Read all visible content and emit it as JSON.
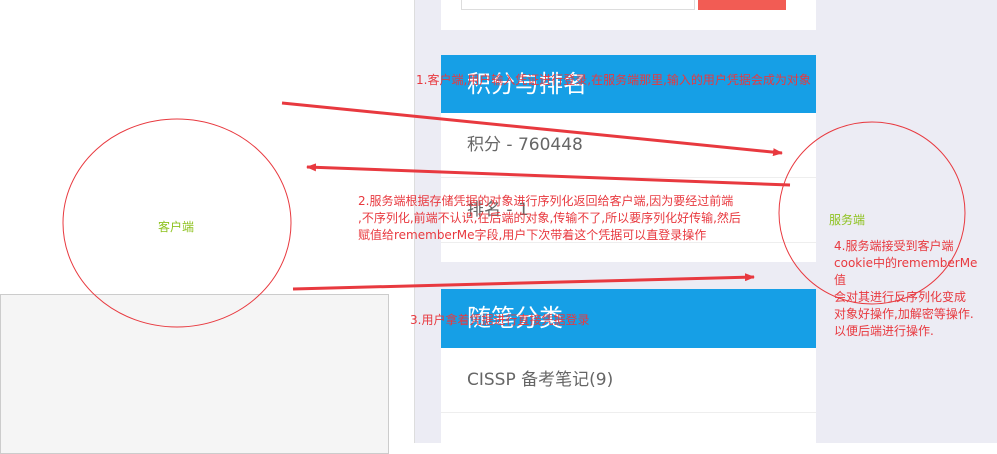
{
  "sidebar": {
    "points_widget": {
      "title": "积分与排名",
      "points": "积分 - 760448",
      "rank": "排名 - 1"
    },
    "categories_widget": {
      "title": "随笔分类",
      "items": [
        "CISSP 备考笔记(9)"
      ]
    }
  },
  "diagram": {
    "client_label": "客户端",
    "server_label": "服务端",
    "step1": "1.客户端,用户输入凭证进行登录,在服务端那里,输入的用户凭据会成为对象",
    "step2": "2.服务端根据存储凭据的对象进行序列化返回给客户端,因为要经过前端\n,不序列化,前端不认识,在后端的对象,传输不了,所以要序列化好传输,然后\n赋值给rememberMe字段,用户下次带着这个凭据可以直登录操作",
    "step3": "3.用户拿着凭据进行直接凭据登录",
    "step4": "4.服务端接受到客户端\ncookie中的rememberMe\n值\n会对其进行反序列化变成\n对象好操作,加解密等操作.\n以便后端进行操作.",
    "colors": {
      "annotation": "#e8393f",
      "node_text": "#8ec21f",
      "widget_header": "#169fe6",
      "search_button": "#f25c54"
    }
  }
}
